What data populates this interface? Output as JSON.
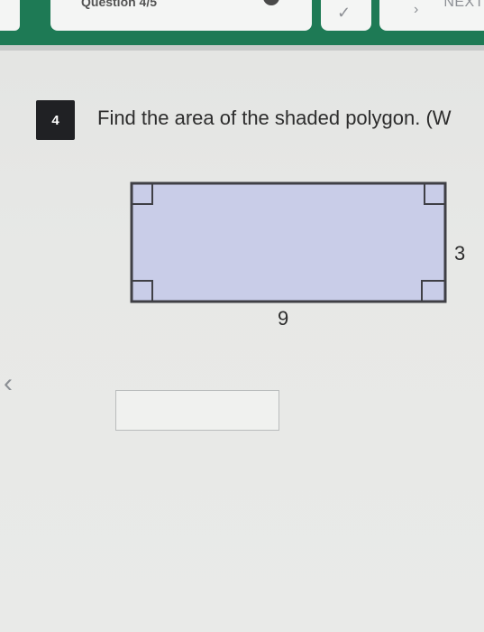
{
  "header": {
    "question_label_partial": "Question 4/5",
    "next_label": "NEXT"
  },
  "question": {
    "number": "4",
    "prompt": "Find the area of the shaded polygon. (W"
  },
  "figure": {
    "shape": "rectangle",
    "fill_color": "#c9cde8",
    "stroke_color": "#3f3f45",
    "width_label": "9",
    "height_label": "3"
  },
  "answer": {
    "value": ""
  },
  "colors": {
    "topbar": "#1e7a55",
    "qnum_bg": "#202124"
  }
}
